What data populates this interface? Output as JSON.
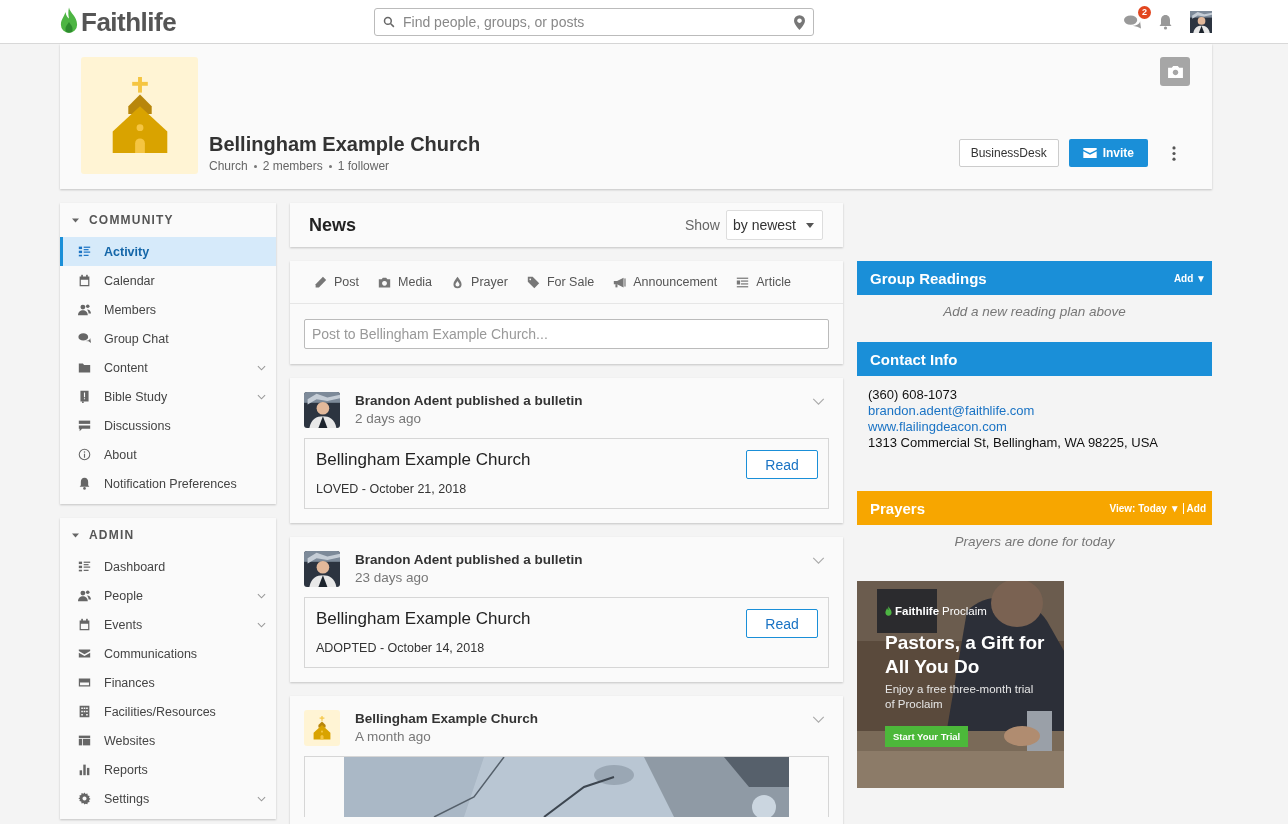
{
  "topbar": {
    "logo": "Faithlife",
    "search": {
      "placeholder": "Find people, groups, or posts"
    },
    "messages_badge": "2"
  },
  "group": {
    "name": "Bellingham Example Church",
    "meta": [
      "Church",
      "2 members",
      "1 follower"
    ],
    "buttons": {
      "secondary": "BusinessDesk",
      "primary": "Invite"
    }
  },
  "sidebar": {
    "sections": [
      {
        "title": "COMMUNITY",
        "expanded": true,
        "items": [
          {
            "label": "Activity",
            "selected": true,
            "expandable": false
          },
          {
            "label": "Calendar",
            "selected": false,
            "expandable": false
          },
          {
            "label": "Members",
            "selected": false,
            "expandable": false
          },
          {
            "label": "Group Chat",
            "selected": false,
            "expandable": false
          },
          {
            "label": "Content",
            "selected": false,
            "expandable": true
          },
          {
            "label": "Bible Study",
            "selected": false,
            "expandable": true
          },
          {
            "label": "Discussions",
            "selected": false,
            "expandable": false
          },
          {
            "label": "About",
            "selected": false,
            "expandable": false
          },
          {
            "label": "Notification Preferences",
            "selected": false,
            "expandable": false
          }
        ]
      },
      {
        "title": "ADMIN",
        "expanded": true,
        "items": [
          {
            "label": "Dashboard",
            "selected": false,
            "expandable": false
          },
          {
            "label": "People",
            "selected": false,
            "expandable": true
          },
          {
            "label": "Events",
            "selected": false,
            "expandable": true
          },
          {
            "label": "Communications",
            "selected": false,
            "expandable": false
          },
          {
            "label": "Finances",
            "selected": false,
            "expandable": false
          },
          {
            "label": "Facilities/Resources",
            "selected": false,
            "expandable": false
          },
          {
            "label": "Websites",
            "selected": false,
            "expandable": false
          },
          {
            "label": "Reports",
            "selected": false,
            "expandable": false
          },
          {
            "label": "Settings",
            "selected": false,
            "expandable": true
          }
        ]
      }
    ]
  },
  "news": {
    "title": "News",
    "show_label": "Show",
    "sort": "by newest"
  },
  "composer": {
    "actions": [
      "Post",
      "Media",
      "Prayer",
      "For Sale",
      "Announcement",
      "Article"
    ],
    "placeholder": "Post to Bellingham Example Church..."
  },
  "feed": [
    {
      "kind": "bulletin",
      "avatar": {
        "kind": "person"
      },
      "headline": "Brandon Adent published a bulletin",
      "time": "2 days ago",
      "title": "Bellingham Example Church",
      "subtitle": "LOVED - October 21, 2018",
      "button": "Read"
    },
    {
      "kind": "bulletin",
      "avatar": {
        "kind": "person"
      },
      "headline": "Brandon Adent published a bulletin",
      "time": "23 days ago",
      "title": "Bellingham Example Church",
      "subtitle": "ADOPTED - October 14, 2018",
      "button": "Read"
    },
    {
      "avatar": {
        "kind": "group"
      },
      "headline": "Bellingham Example Church",
      "time": "A month ago"
    }
  ],
  "widgets": [
    {
      "kind": "readings",
      "title": "Group Readings",
      "color": "#1a8fd8",
      "actions": [
        "Add ▼"
      ],
      "empty": "Add a new reading plan above"
    },
    {
      "kind": "contact",
      "title": "Contact Info",
      "color": "#1a8fd8",
      "phone": "(360) 608-1073",
      "email": "brandon.adent@faithlife.com",
      "website": "www.flailingdeacon.com",
      "address": "1313 Commercial St, Bellingham, WA 98225, USA"
    },
    {
      "kind": "prayers",
      "title": "Prayers",
      "color": "#f7a600",
      "actions": [
        "View: Today ▼",
        "Add"
      ],
      "empty": "Prayers are done for today"
    }
  ],
  "ad": {
    "brand": "Faithlife",
    "product": "Proclaim",
    "headline": "Pastors, a Gift for All You Do",
    "body": "Enjoy a free three-month trial of Proclaim",
    "cta": "Start Your Trial"
  }
}
